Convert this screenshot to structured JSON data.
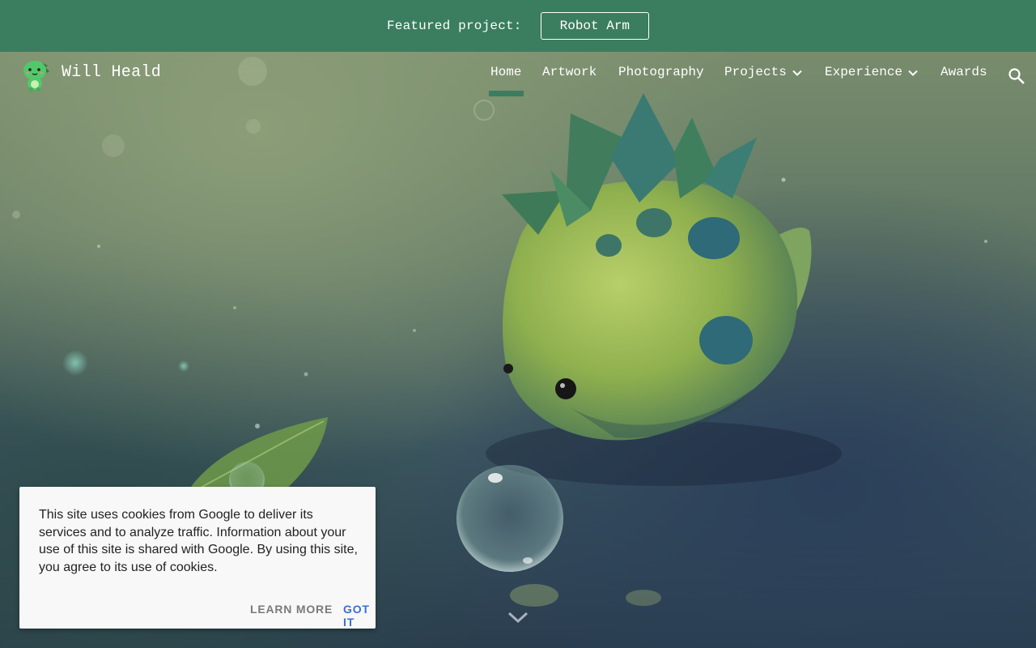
{
  "banner": {
    "label": "Featured project:",
    "button_label": "Robot Arm"
  },
  "header": {
    "site_title": "Will Heald",
    "nav": [
      {
        "label": "Home",
        "active": true
      },
      {
        "label": "Artwork"
      },
      {
        "label": "Photography"
      },
      {
        "label": "Projects",
        "has_dropdown": true
      },
      {
        "label": "Experience",
        "has_dropdown": true
      },
      {
        "label": "Awards"
      }
    ]
  },
  "icons": {
    "logo": "dinosaur-logo-icon",
    "search": "search-icon",
    "dropdown": "chevron-down-icon",
    "scroll": "chevron-down-icon"
  },
  "cookie_notice": {
    "text": "This site uses cookies from Google to deliver its services and to analyze traffic. Information about your use of this site is shared with Google. By using this site, you agree to its use of cookies.",
    "learn_more_label": "LEARN MORE",
    "got_it_label": "GOT IT"
  },
  "colors": {
    "brand_green": "#3b7d5f",
    "link_blue": "#3a6fd0",
    "dialog_bg": "#f8f8f8"
  }
}
